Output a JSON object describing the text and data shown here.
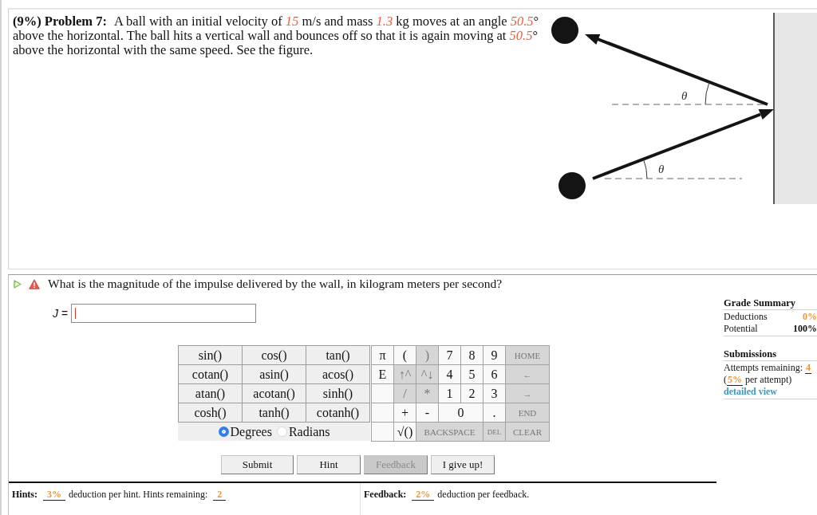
{
  "problem": {
    "title": "(9%) Problem 7:",
    "statement": "A ball with an initial velocity of *15* m/s and mass *1.3* kg moves at an angle *50.5*° above the horizontal. The ball hits a vertical wall and bounces off so that it is again moving at *50.5*° above the horizontal with the same speed. See the figure.",
    "figure": {
      "angle_labels": [
        "θ",
        "θ"
      ]
    }
  },
  "question": {
    "text": "What is the magnitude of the impulse delivered by the wall, in kilogram meters per second?",
    "answer_label": "*J* ="
  },
  "calculator": {
    "functions": [
      "sin()",
      "cos()",
      "tan()",
      "cotan()",
      "asin()",
      "acos()",
      "atan()",
      "acotan()",
      "sinh()",
      "cosh()",
      "tanh()",
      "cotanh()"
    ],
    "angle_modes": [
      {
        "label": "Degrees",
        "selected": true
      },
      {
        "label": "Radians",
        "selected": false
      }
    ],
    "keys": [
      [
        {
          "label": "π",
          "kind": "key",
          "disabled": false
        },
        {
          "label": "(",
          "kind": "key",
          "disabled": false
        },
        {
          "label": ")",
          "kind": "key",
          "disabled": true
        },
        {
          "label": "7",
          "kind": "key",
          "disabled": false
        },
        {
          "label": "8",
          "kind": "key",
          "disabled": false
        },
        {
          "label": "9",
          "kind": "key",
          "disabled": false
        },
        {
          "label": "HOME",
          "kind": "label",
          "disabled": true
        }
      ],
      [
        {
          "label": "E",
          "kind": "key",
          "disabled": false
        },
        {
          "label": "↑^",
          "kind": "key",
          "disabled": true
        },
        {
          "label": "^↓",
          "kind": "key",
          "disabled": true
        },
        {
          "label": "4",
          "kind": "key",
          "disabled": false
        },
        {
          "label": "5",
          "kind": "key",
          "disabled": false
        },
        {
          "label": "6",
          "kind": "key",
          "disabled": false
        },
        {
          "label": "←",
          "kind": "label",
          "disabled": true
        }
      ],
      [
        {
          "kind": "blank",
          "disabled": false
        },
        {
          "label": "/",
          "kind": "key",
          "disabled": true
        },
        {
          "label": "*",
          "kind": "key",
          "disabled": true
        },
        {
          "label": "1",
          "kind": "key",
          "disabled": false
        },
        {
          "label": "2",
          "kind": "key",
          "disabled": false
        },
        {
          "label": "3",
          "kind": "key",
          "disabled": false
        },
        {
          "label": "→",
          "kind": "label",
          "disabled": true
        }
      ],
      [
        {
          "kind": "blank",
          "disabled": false
        },
        {
          "label": "+",
          "kind": "key",
          "disabled": false
        },
        {
          "label": "-",
          "kind": "key",
          "disabled": false
        },
        {
          "label": "0",
          "kind": "double",
          "disabled": false
        },
        {
          "label": ".",
          "kind": "key",
          "disabled": false
        },
        {
          "label": "END",
          "kind": "label",
          "disabled": true
        }
      ],
      [
        {
          "kind": "blank",
          "disabled": false
        },
        {
          "label": "√()",
          "kind": "key",
          "disabled": false
        },
        {
          "label": "BACKSPACE",
          "kind": "wide",
          "disabled": true
        },
        {
          "label": "DEL",
          "kind": "tiny",
          "disabled": true
        },
        {
          "label": "CLEAR",
          "kind": "label",
          "disabled": true
        }
      ]
    ]
  },
  "buttons": [
    {
      "label": "Submit",
      "disabled": false
    },
    {
      "label": "Hint",
      "disabled": false
    },
    {
      "label": "Feedback",
      "disabled": true
    },
    {
      "label": "I give up!",
      "disabled": false
    }
  ],
  "hints": {
    "label": "Hints:",
    "deduction": "3%",
    "text": "deduction per hint. Hints remaining:",
    "remaining": "2"
  },
  "feedback": {
    "label": "Feedback:",
    "deduction": "2%",
    "text": "deduction per feedback."
  },
  "grade_summary": {
    "title": "Grade Summary",
    "rows": [
      {
        "label": "Deductions",
        "value": "0%",
        "kind": "deduction"
      },
      {
        "label": "Potential",
        "value": "100%",
        "kind": "potential"
      }
    ]
  },
  "submissions": {
    "title": "Submissions",
    "attempts_label": "Attempts remaining:",
    "attempts": "4",
    "per_attempt_prefix": "(",
    "per_attempt": "5%",
    "per_attempt_suffix": "per attempt)",
    "link": "detailed view"
  }
}
